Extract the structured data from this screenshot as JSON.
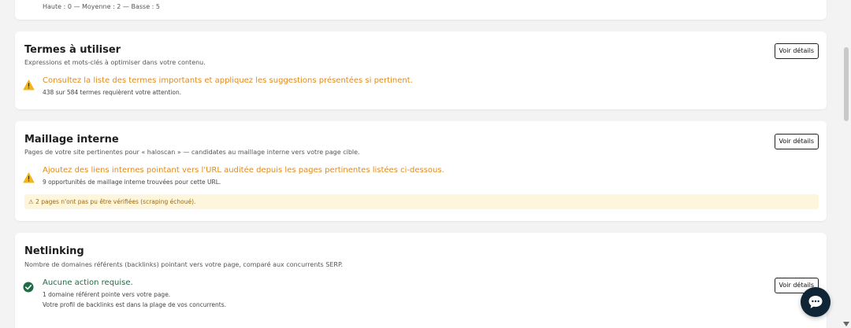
{
  "top_card": {
    "summary": "Haute : 0 — Moyenne : 2 — Basse : 5"
  },
  "termes": {
    "title": "Termes à utiliser",
    "subtitle": "Expressions et mots-clés à optimiser dans votre contenu.",
    "status_text": "Consultez la liste des termes importants et appliquez les suggestions présentées si pertinent.",
    "status_sub": "438 sur 584 termes requièrent votre attention.",
    "button_label": "Voir détails"
  },
  "maillage": {
    "title": "Maillage interne",
    "subtitle": "Pages de votre site pertinentes pour « haloscan » — candidates au maillage interne vers votre page cible.",
    "status_text": "Ajoutez des liens internes pointant vers l'URL auditée depuis les pages pertinentes listées ci-dessous.",
    "status_sub": "9 opportunités de maillage interne trouvées pour cette URL.",
    "notice": "⚠ 2 pages n'ont pas pu être vérifiées (scraping échoué).",
    "button_label": "Voir détails"
  },
  "netlinking": {
    "title": "Netlinking",
    "subtitle": "Nombre de domaines référents (backlinks) pointant vers votre page, comparé aux concurrents SERP.",
    "status_text": "Aucune action requise.",
    "status_sub_1": "1 domaine référent pointe vers votre page.",
    "status_sub_2": "Votre profil de backlinks est dans la plage de vos concurrents.",
    "button_label": "Voir détails"
  },
  "colors": {
    "warning": "#e08a1e",
    "success": "#1f6b45",
    "chat_bubble": "#0f2535",
    "notice_bg": "#fdf6dc"
  },
  "icons": {
    "warning": "warning-triangle-icon",
    "success": "check-circle-icon",
    "chat": "chat-bubble-icon"
  }
}
